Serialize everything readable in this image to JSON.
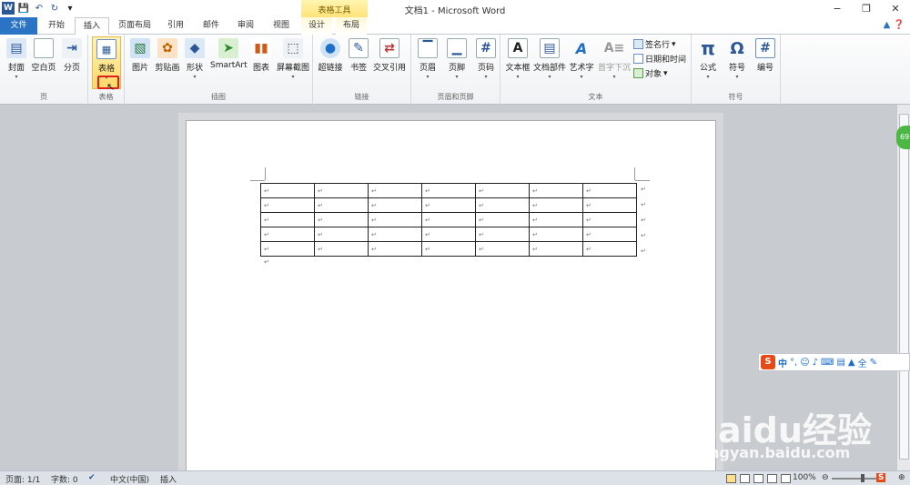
{
  "titlebar": {
    "doc_title": "文档1 - Microsoft Word",
    "context_group": "表格工具",
    "qat": [
      "word-logo",
      "save-icon",
      "undo-icon",
      "redo-icon",
      "customize-icon"
    ],
    "controls": {
      "minimize": "−",
      "restore": "❐",
      "close": "✕"
    }
  },
  "tabs": {
    "file": "文件",
    "home": "开始",
    "insert": "插入",
    "layout": "页面布局",
    "references": "引用",
    "mailings": "邮件",
    "review": "审阅",
    "view": "视图",
    "design": "设计",
    "table_layout": "布局"
  },
  "ribbon": {
    "pages": {
      "label": "页",
      "cover": "封面",
      "blank": "空白页",
      "break": "分页"
    },
    "tables": {
      "label": "表格",
      "table": "表格"
    },
    "illustrations": {
      "label": "插图",
      "picture": "图片",
      "clipart": "剪贴画",
      "shapes": "形状",
      "smartart": "SmartArt",
      "chart": "图表",
      "screenshot": "屏幕截图"
    },
    "links": {
      "label": "链接",
      "hyperlink": "超链接",
      "bookmark": "书签",
      "crossref": "交叉引用"
    },
    "header_footer": {
      "label": "页眉和页脚",
      "header": "页眉",
      "footer": "页脚",
      "pagenum": "页码"
    },
    "text": {
      "label": "文本",
      "textbox": "文本框",
      "quickparts": "文档部件",
      "wordart": "艺术字",
      "dropcap": "首字下沉",
      "signature": "签名行",
      "datetime": "日期和时间",
      "object": "对象"
    },
    "symbols": {
      "label": "符号",
      "equation": "公式",
      "symbol": "符号",
      "number": "编号"
    }
  },
  "ime": {
    "lang": "中",
    "punct": "°,",
    "full": "全"
  },
  "watermark": {
    "brand": "Baidu经验",
    "url": "jingyan.baidu.com"
  },
  "badge": "69",
  "statusbar": {
    "page": "页面: 1/1",
    "words": "字数: 0",
    "lang": "中文(中国)",
    "mode": "插入",
    "zoom": "100%"
  },
  "table": {
    "rows": 5,
    "cols": 7,
    "cell_mark": "↵"
  }
}
